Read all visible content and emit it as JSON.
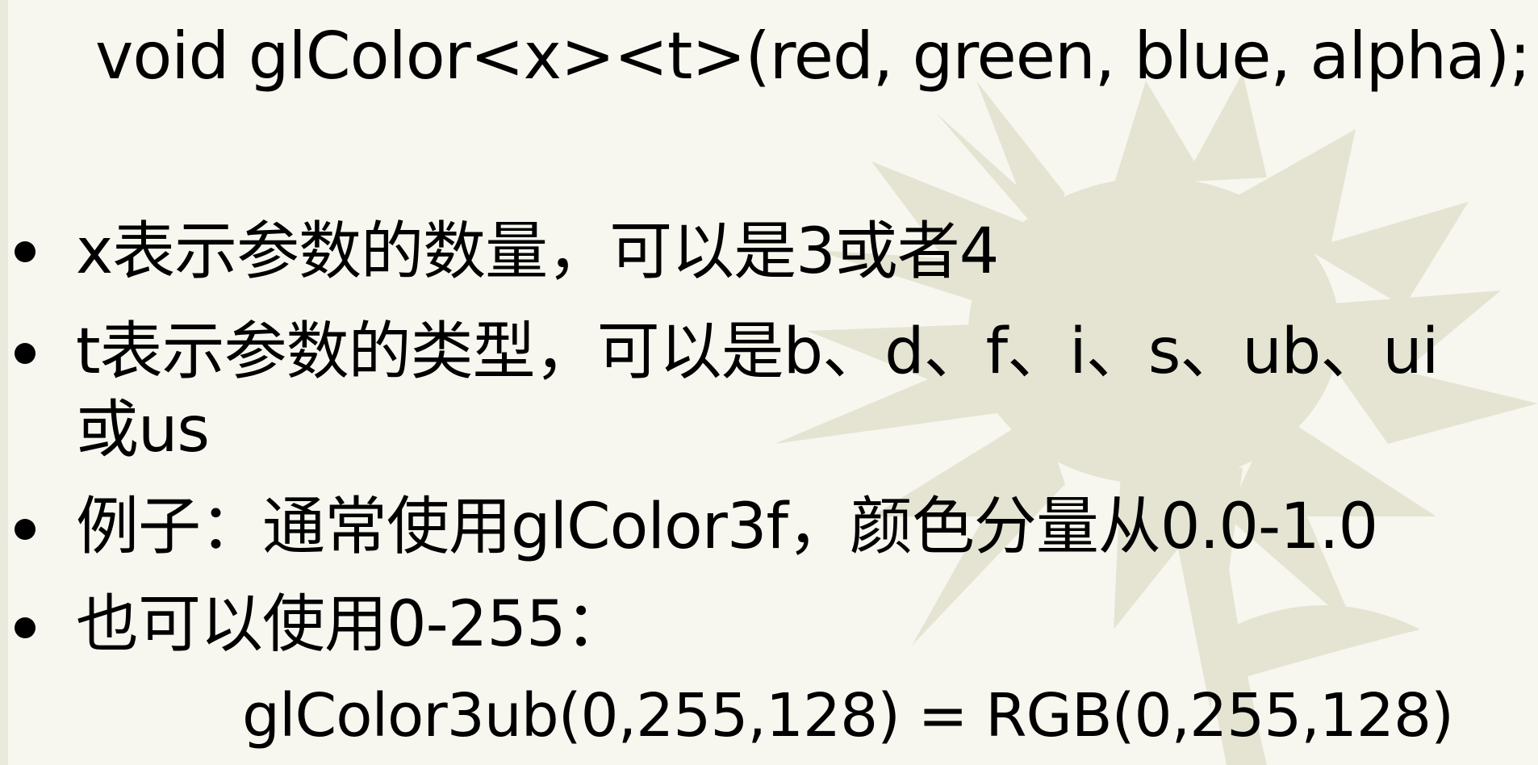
{
  "slide": {
    "title": "void glColor<x><t>(red, green, blue, alpha);",
    "bullets": [
      {
        "text": "x表示参数的数量，可以是3或者4"
      },
      {
        "line1": "t表示参数的类型，可以是b、d、f、i、s、ub、ui",
        "line2": "或us"
      },
      {
        "text": "例子：通常使用glColor3f，颜色分量从0.0-1.0"
      },
      {
        "text": "也可以使用0-255："
      }
    ],
    "code_line": "glColor3ub(0,255,128) = RGB(0,255,128)"
  },
  "colors": {
    "background": "#f7f7f0",
    "flower_silhouette": "#e5e4d3",
    "text": "#000000"
  },
  "icons": {
    "decoration": "flower-silhouette-icon",
    "bullet": "bullet-dot-icon"
  }
}
